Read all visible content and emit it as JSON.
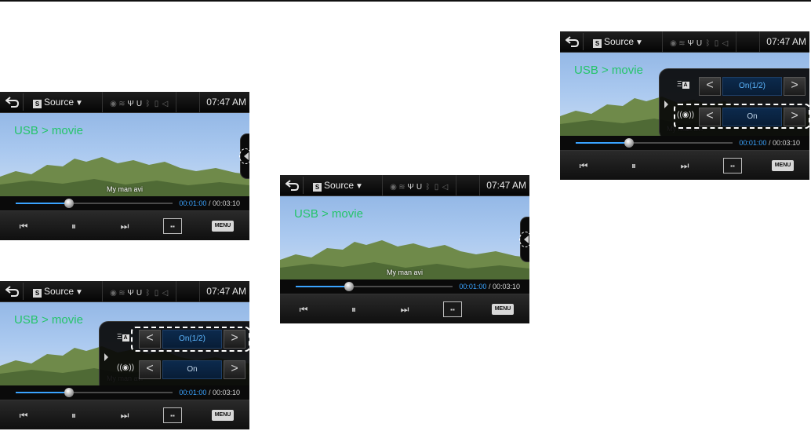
{
  "statusbar": {
    "source_label": "Source",
    "source_arrow": "▼",
    "clock": "07:47 AM",
    "icons": [
      "back-icon",
      "source-icon",
      "gps-icon",
      "wifi-icon",
      "usb-icon",
      "usb-u-icon",
      "bluetooth-icon",
      "phone-icon",
      "speaker-icon"
    ]
  },
  "video": {
    "breadcrumb": "USB > movie",
    "filename": "My man avi"
  },
  "progress": {
    "elapsed": "00:01:00",
    "separator": " / ",
    "total": "00:03:10",
    "fraction": 0.34
  },
  "progress_alt": {
    "elapsed": "00:01:00",
    "separator": " / ",
    "total": "00:03:10",
    "fraction": 0.34
  },
  "options": {
    "subtitle_value": "On(1/2)",
    "audio_value": "On",
    "prev_symbol": "<",
    "next_symbol": ">"
  },
  "controls": {
    "prev_symbol": "⏮",
    "pause_symbol": "⏸",
    "next_symbol": "⏭",
    "aspect_symbol": "▪▪",
    "menu_label": "MENU"
  },
  "colors": {
    "breadcrumb": "#25c46a",
    "progress_accent": "#3aa3ff",
    "option_value": "#5cb7ff"
  }
}
